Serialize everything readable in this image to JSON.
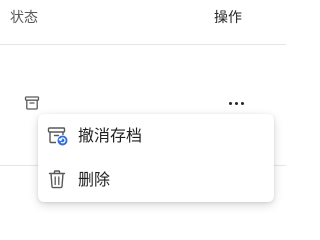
{
  "table": {
    "headers": {
      "status": "状态",
      "actions": "操作"
    },
    "row": {
      "status_icon": "archive-icon",
      "actions_icon": "more-horizontal-icon"
    }
  },
  "context_menu": {
    "items": [
      {
        "label": "撤消存档",
        "icon": "unarchive-icon"
      },
      {
        "label": "删除",
        "icon": "trash-icon"
      }
    ]
  },
  "colors": {
    "icon_gray": "#595959",
    "accent_blue": "#2f6fdf",
    "text": "#1f1f1f",
    "divider": "#e6e6e6"
  }
}
